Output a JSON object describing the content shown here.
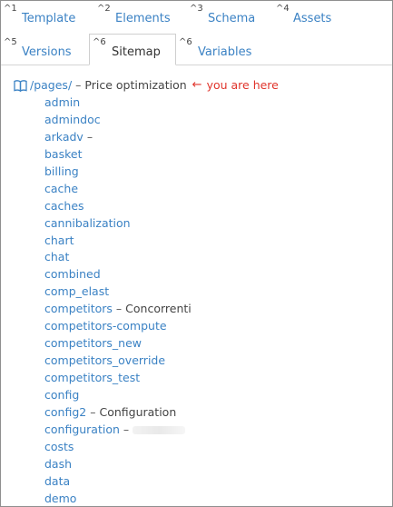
{
  "tabs": [
    {
      "key": "^1",
      "label": "Template"
    },
    {
      "key": "^2",
      "label": "Elements"
    },
    {
      "key": "^3",
      "label": "Schema"
    },
    {
      "key": "^4",
      "label": "Assets"
    },
    {
      "key": "^5",
      "label": "Versions"
    },
    {
      "key": "^6",
      "label": "Sitemap"
    },
    {
      "key": "^6",
      "label": "Variables"
    }
  ],
  "active_tab": "Sitemap",
  "header": {
    "path": "/pages/",
    "separator": "–",
    "description": "Price optimization",
    "arrow": "←",
    "here_text": "you are here"
  },
  "pages": [
    {
      "name": "admin"
    },
    {
      "name": "admindoc"
    },
    {
      "name": "arkadv",
      "sep": "–"
    },
    {
      "name": "basket"
    },
    {
      "name": "billing"
    },
    {
      "name": "cache"
    },
    {
      "name": "caches"
    },
    {
      "name": "cannibalization"
    },
    {
      "name": "chart"
    },
    {
      "name": "chat"
    },
    {
      "name": "combined"
    },
    {
      "name": "comp_elast"
    },
    {
      "name": "competitors",
      "sep": "–",
      "note": "Concorrenti"
    },
    {
      "name": "competitors-compute"
    },
    {
      "name": "competitors_new"
    },
    {
      "name": "competitors_override"
    },
    {
      "name": "competitors_test"
    },
    {
      "name": "config"
    },
    {
      "name": "config2",
      "sep": "–",
      "note": "Configuration"
    },
    {
      "name": "configuration",
      "sep": "–",
      "blurred": true
    },
    {
      "name": "costs"
    },
    {
      "name": "dash"
    },
    {
      "name": "data"
    },
    {
      "name": "demo"
    }
  ],
  "colors": {
    "link": "#3b82c4",
    "here": "#e0342b",
    "text": "#444444"
  }
}
